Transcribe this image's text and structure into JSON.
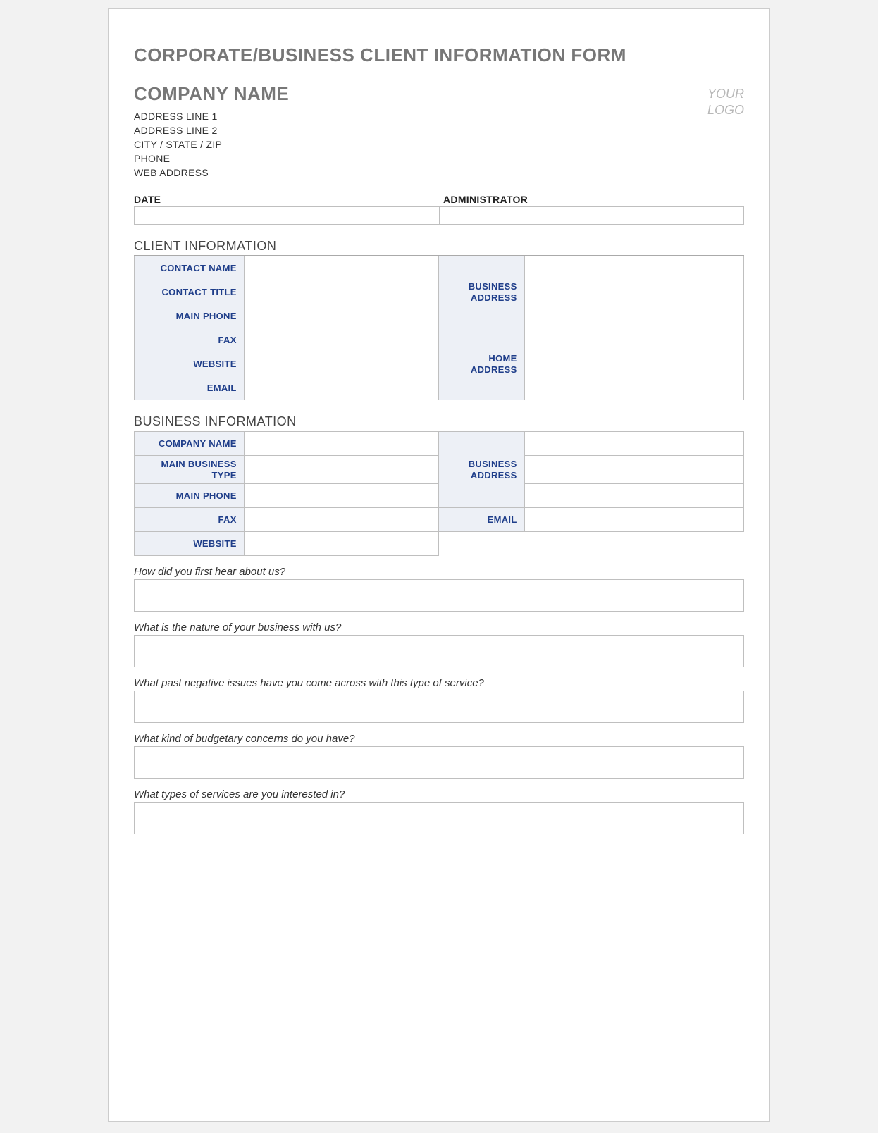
{
  "title": "CORPORATE/BUSINESS CLIENT INFORMATION FORM",
  "company": {
    "name": "COMPANY NAME",
    "addr1": "ADDRESS LINE 1",
    "addr2": "ADDRESS LINE 2",
    "csz": "CITY / STATE / ZIP",
    "phone": "PHONE",
    "web": "WEB ADDRESS"
  },
  "logo": {
    "line1": "YOUR",
    "line2": "LOGO"
  },
  "meta": {
    "date_label": "DATE",
    "admin_label": "ADMINISTRATOR"
  },
  "sections": {
    "client": "CLIENT INFORMATION",
    "business": "BUSINESS INFORMATION"
  },
  "client": {
    "contact_name": "CONTACT NAME",
    "contact_title": "CONTACT TITLE",
    "main_phone": "MAIN PHONE",
    "fax": "FAX",
    "website": "WEBSITE",
    "email": "EMAIL",
    "business_address_l1": "BUSINESS",
    "business_address_l2": "ADDRESS",
    "home_address_l1": "HOME",
    "home_address_l2": "ADDRESS"
  },
  "business": {
    "company_name": "COMPANY NAME",
    "main_business_type_l1": "MAIN BUSINESS",
    "main_business_type_l2": "TYPE",
    "main_phone": "MAIN PHONE",
    "fax": "FAX",
    "website": "WEBSITE",
    "business_address_l1": "BUSINESS",
    "business_address_l2": "ADDRESS",
    "email": "EMAIL"
  },
  "questions": {
    "q1": "How did you first hear about us?",
    "q2": "What is the nature of your business with us?",
    "q3": "What past negative issues have you come across with this type of service?",
    "q4": "What kind of budgetary concerns do you have?",
    "q5": "What types of services are you interested in?"
  }
}
